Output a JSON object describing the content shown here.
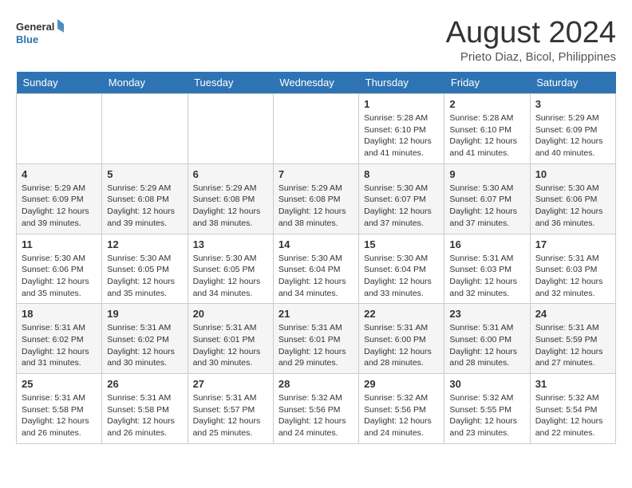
{
  "header": {
    "logo_line1": "General",
    "logo_line2": "Blue",
    "month": "August 2024",
    "location": "Prieto Diaz, Bicol, Philippines"
  },
  "weekdays": [
    "Sunday",
    "Monday",
    "Tuesday",
    "Wednesday",
    "Thursday",
    "Friday",
    "Saturday"
  ],
  "weeks": [
    [
      {
        "day": "",
        "info": ""
      },
      {
        "day": "",
        "info": ""
      },
      {
        "day": "",
        "info": ""
      },
      {
        "day": "",
        "info": ""
      },
      {
        "day": "1",
        "info": "Sunrise: 5:28 AM\nSunset: 6:10 PM\nDaylight: 12 hours\nand 41 minutes."
      },
      {
        "day": "2",
        "info": "Sunrise: 5:28 AM\nSunset: 6:10 PM\nDaylight: 12 hours\nand 41 minutes."
      },
      {
        "day": "3",
        "info": "Sunrise: 5:29 AM\nSunset: 6:09 PM\nDaylight: 12 hours\nand 40 minutes."
      }
    ],
    [
      {
        "day": "4",
        "info": "Sunrise: 5:29 AM\nSunset: 6:09 PM\nDaylight: 12 hours\nand 39 minutes."
      },
      {
        "day": "5",
        "info": "Sunrise: 5:29 AM\nSunset: 6:08 PM\nDaylight: 12 hours\nand 39 minutes."
      },
      {
        "day": "6",
        "info": "Sunrise: 5:29 AM\nSunset: 6:08 PM\nDaylight: 12 hours\nand 38 minutes."
      },
      {
        "day": "7",
        "info": "Sunrise: 5:29 AM\nSunset: 6:08 PM\nDaylight: 12 hours\nand 38 minutes."
      },
      {
        "day": "8",
        "info": "Sunrise: 5:30 AM\nSunset: 6:07 PM\nDaylight: 12 hours\nand 37 minutes."
      },
      {
        "day": "9",
        "info": "Sunrise: 5:30 AM\nSunset: 6:07 PM\nDaylight: 12 hours\nand 37 minutes."
      },
      {
        "day": "10",
        "info": "Sunrise: 5:30 AM\nSunset: 6:06 PM\nDaylight: 12 hours\nand 36 minutes."
      }
    ],
    [
      {
        "day": "11",
        "info": "Sunrise: 5:30 AM\nSunset: 6:06 PM\nDaylight: 12 hours\nand 35 minutes."
      },
      {
        "day": "12",
        "info": "Sunrise: 5:30 AM\nSunset: 6:05 PM\nDaylight: 12 hours\nand 35 minutes."
      },
      {
        "day": "13",
        "info": "Sunrise: 5:30 AM\nSunset: 6:05 PM\nDaylight: 12 hours\nand 34 minutes."
      },
      {
        "day": "14",
        "info": "Sunrise: 5:30 AM\nSunset: 6:04 PM\nDaylight: 12 hours\nand 34 minutes."
      },
      {
        "day": "15",
        "info": "Sunrise: 5:30 AM\nSunset: 6:04 PM\nDaylight: 12 hours\nand 33 minutes."
      },
      {
        "day": "16",
        "info": "Sunrise: 5:31 AM\nSunset: 6:03 PM\nDaylight: 12 hours\nand 32 minutes."
      },
      {
        "day": "17",
        "info": "Sunrise: 5:31 AM\nSunset: 6:03 PM\nDaylight: 12 hours\nand 32 minutes."
      }
    ],
    [
      {
        "day": "18",
        "info": "Sunrise: 5:31 AM\nSunset: 6:02 PM\nDaylight: 12 hours\nand 31 minutes."
      },
      {
        "day": "19",
        "info": "Sunrise: 5:31 AM\nSunset: 6:02 PM\nDaylight: 12 hours\nand 30 minutes."
      },
      {
        "day": "20",
        "info": "Sunrise: 5:31 AM\nSunset: 6:01 PM\nDaylight: 12 hours\nand 30 minutes."
      },
      {
        "day": "21",
        "info": "Sunrise: 5:31 AM\nSunset: 6:01 PM\nDaylight: 12 hours\nand 29 minutes."
      },
      {
        "day": "22",
        "info": "Sunrise: 5:31 AM\nSunset: 6:00 PM\nDaylight: 12 hours\nand 28 minutes."
      },
      {
        "day": "23",
        "info": "Sunrise: 5:31 AM\nSunset: 6:00 PM\nDaylight: 12 hours\nand 28 minutes."
      },
      {
        "day": "24",
        "info": "Sunrise: 5:31 AM\nSunset: 5:59 PM\nDaylight: 12 hours\nand 27 minutes."
      }
    ],
    [
      {
        "day": "25",
        "info": "Sunrise: 5:31 AM\nSunset: 5:58 PM\nDaylight: 12 hours\nand 26 minutes."
      },
      {
        "day": "26",
        "info": "Sunrise: 5:31 AM\nSunset: 5:58 PM\nDaylight: 12 hours\nand 26 minutes."
      },
      {
        "day": "27",
        "info": "Sunrise: 5:31 AM\nSunset: 5:57 PM\nDaylight: 12 hours\nand 25 minutes."
      },
      {
        "day": "28",
        "info": "Sunrise: 5:32 AM\nSunset: 5:56 PM\nDaylight: 12 hours\nand 24 minutes."
      },
      {
        "day": "29",
        "info": "Sunrise: 5:32 AM\nSunset: 5:56 PM\nDaylight: 12 hours\nand 24 minutes."
      },
      {
        "day": "30",
        "info": "Sunrise: 5:32 AM\nSunset: 5:55 PM\nDaylight: 12 hours\nand 23 minutes."
      },
      {
        "day": "31",
        "info": "Sunrise: 5:32 AM\nSunset: 5:54 PM\nDaylight: 12 hours\nand 22 minutes."
      }
    ]
  ]
}
